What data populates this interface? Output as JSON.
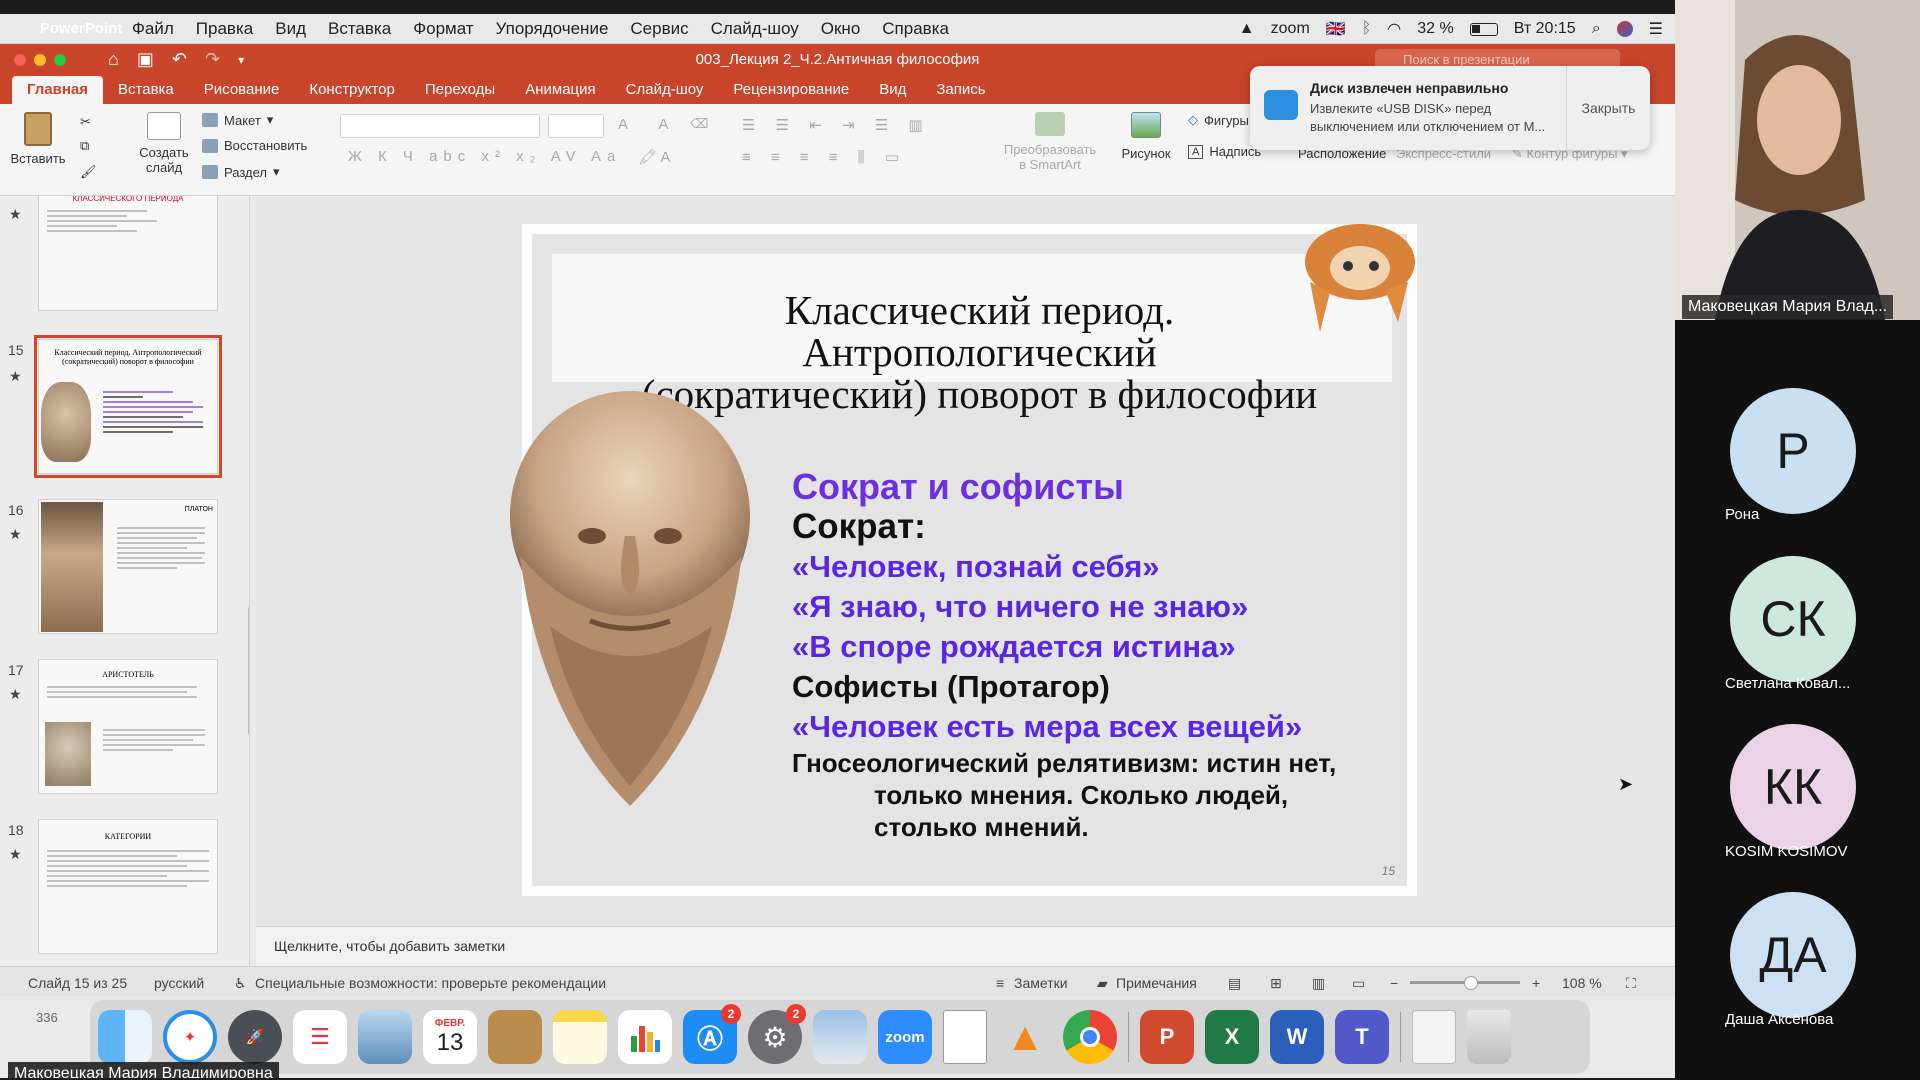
{
  "menubar": {
    "app_name": "PowerPoint",
    "items": [
      "Файл",
      "Правка",
      "Вид",
      "Вставка",
      "Формат",
      "Упорядочение",
      "Сервис",
      "Слайд-шоу",
      "Окно",
      "Справка"
    ],
    "zoom_label": "zoom",
    "battery": "32 %",
    "clock": "Вт 20:15"
  },
  "window": {
    "title": "003_Лекция 2_Ч.2.Античная философия",
    "search_placeholder": "Поиск в презентации"
  },
  "ribbon_tabs": [
    "Главная",
    "Вставка",
    "Рисование",
    "Конструктор",
    "Переходы",
    "Анимация",
    "Слайд-шоу",
    "Рецензирование",
    "Вид",
    "Запись"
  ],
  "ribbon": {
    "paste": "Вставить",
    "new_slide": "Создать слайд",
    "layout": "Макет",
    "reset": "Восстановить",
    "section": "Раздел",
    "smartart": "Преобразовать в SmartArt",
    "picture": "Рисунок",
    "shapes": "Фигуры",
    "textbox": "Надпись",
    "arrange": "Расположение",
    "quick_styles": "Экспресс-стили",
    "shape_outline": "Контур фигуры"
  },
  "notification": {
    "title": "Диск извлечен неправильно",
    "body": "Извлеките «USB DISK» перед выключением или отключением от М...",
    "close": "Закрыть"
  },
  "thumbnails": [
    {
      "num": "",
      "caption": "ОСНОВНЫЕ НАПРАВЛЕНИЯ КЛАССИЧЕСКОГО ПЕРИОДА"
    },
    {
      "num": "15",
      "caption": "Классический период. Антропологический (сократический) поворот в философии"
    },
    {
      "num": "16",
      "caption": "ПЛАТОН"
    },
    {
      "num": "17",
      "caption": "АРИСТОТЕЛЬ"
    },
    {
      "num": "18",
      "caption": "КАТЕГОРИИ"
    }
  ],
  "slide": {
    "title_lines": [
      "Классический период.",
      "Антропологический",
      "(сократический) поворот в философии"
    ],
    "lines": [
      "Сократ и софисты",
      "Сократ:",
      "«Человек, познай себя»",
      "«Я знаю, что ничего не знаю»",
      "«В споре рождается истина»",
      "Софисты (Протагор)",
      "«Человек есть мера всех вещей»",
      "Гносеологический релятивизм: истин нет,",
      "только мнения. Сколько людей,",
      "столько мнений."
    ],
    "page_number": "15"
  },
  "notes_placeholder": "Щелкните, чтобы добавить заметки",
  "status": {
    "slide_counter": "Слайд 15 из 25",
    "language": "русский",
    "accessibility": "Специальные возможности: проверьте рекомендации",
    "notes": "Заметки",
    "comments": "Примечания",
    "zoom": "108 %"
  },
  "dock": {
    "counter": "336",
    "calendar_month": "ФЕВР.",
    "calendar_day": "13",
    "appstore_badge": "2",
    "settings_badge": "2",
    "zoom_label": "zoom",
    "items": [
      "finder",
      "safari",
      "launchpad",
      "reminders",
      "preview",
      "calendar",
      "contacts",
      "notes",
      "numbers",
      "app-store",
      "system-preferences",
      "image-capture",
      "zoom",
      "text-document",
      "vlc",
      "chrome",
      "powerpoint",
      "excel",
      "word",
      "teams",
      "documents",
      "trash"
    ]
  },
  "screen_share_owner": "Маковецкая Мария Владимировна",
  "participants": {
    "video_name": "Маковецкая Мария Влад...",
    "list": [
      {
        "initials": "Р",
        "name": "Рона",
        "color": "#c9e0f3"
      },
      {
        "initials": "СК",
        "name": "Светлана Ковал...",
        "color": "#cfe8dd"
      },
      {
        "initials": "КК",
        "name": "KOSIM KOSIMOV",
        "color": "#ead3e6"
      },
      {
        "initials": "ДА",
        "name": "Даша Аксёнова",
        "color": "#cde0f4"
      }
    ]
  },
  "colors": {
    "ppt_accent": "#c8442b",
    "slide_purple": "#6b2fe0",
    "slide_violet": "#5a26e6"
  }
}
